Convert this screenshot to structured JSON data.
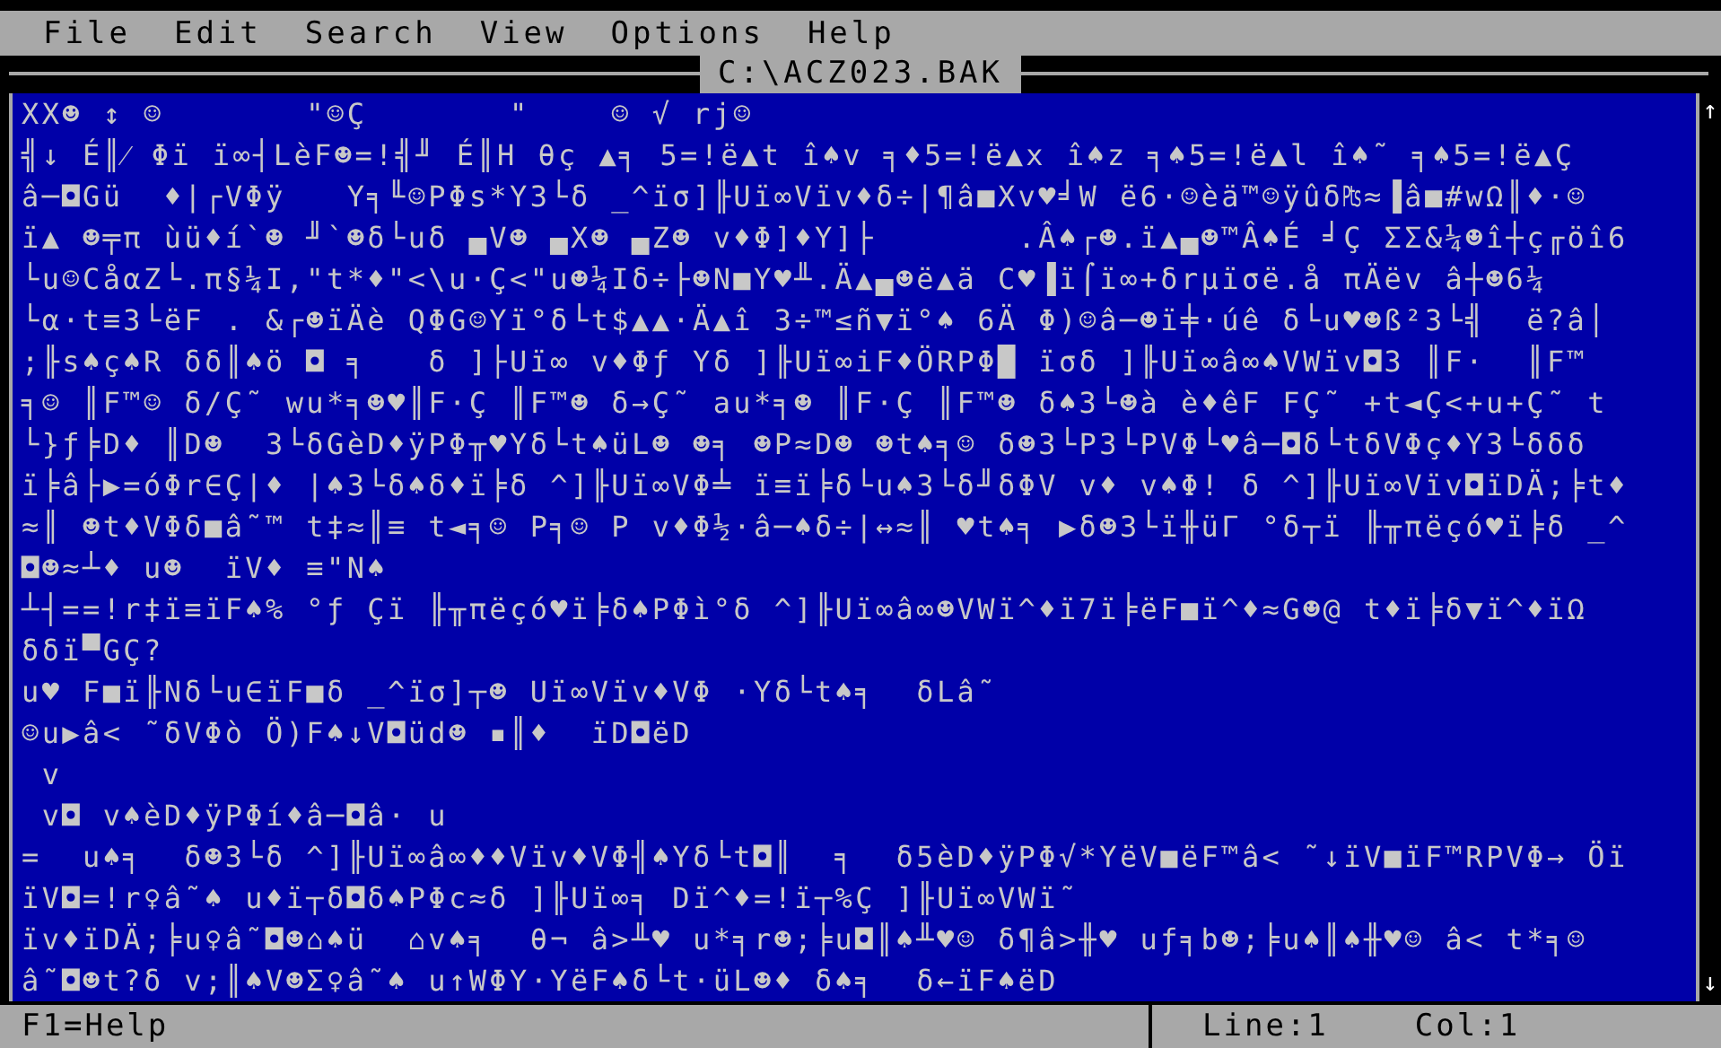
{
  "menu": [
    "File",
    "Edit",
    "Search",
    "View",
    "Options",
    "Help"
  ],
  "window": {
    "title": "C:\\ACZ023.BAK"
  },
  "lines": [
    "XX☻ ↕ ☺       \"☺Ç       \"    ☺ √ rj☺",
    "╣↓ É║⁄ Φï ï∞┤LèF☻=!╣╜ É║H θç ▲╕ 5=!ë▲t î♠v ╕♦5=!ë▲x î♠z ╕♠5=!ë▲l î♠˜ ╕♠5=!ë▲Ç",
    "â─◘Gü  ♦|┌VΦÿ   Y╕╙☺PΦs*Y3└δ _^ïσ]╟Uï∞Vïv♦δ÷|¶â■Xv♥╛W ë6·☺èä™☺ÿûδ₧≈▐â■#wΩ║♦·☺",
    "ï▲ ☻╤π ùü♦í`☻ ╜`☻δ└uδ ▄V☻ ▄X☻ ▄Z☻ v♦Φ]♦Y]├       .Â♠┌☻.ï▲▄☻™Â♠É ╛Ç ΣΣ&¼☻î┼ç╓öî6",
    "└u☺CåαZ└.π§¼I,\"t*♦\"<\\u·Ç<\"u☻¼Iδ÷├☻N■Y♥╨.Ä▲▄☻ë▲ä C♥▐ï⌠ï∞+δrµïσë.å πÄëv â┼☻6¼",
    "└α·t≡3└ëF . &┌☻ïÄè QΦG☺Yï°δ└t$▲▲·Ä▲î 3÷™≤ñ▼ï°♠ 6Ä Φ)☺â─☻ï╪·úê δ└u♥☻ß²3└╣  ë?â│",
    ";╟s♠ç♠R δδ║♠ö ◘ ╕   δ ]├Uï∞ v♦Φƒ Yδ ]╟Uï∞iF♦ÖRPΦ█ ïσδ ]╟Uï∞â∞♠VWïv◘3 ║F·  ║F™",
    "╕☺ ║F™☺ δ/Ç˜ wu*╕☻♥║F·Ç ║F™☻ δ→Ç˜ au*╕☻ ║F·Ç ║F™☻ δ♠3└☻à è♦êF FÇ˜ +t◄Ç<+u+Ç˜ t",
    "└}ƒ╞D♦ ║D☻  3└δGèD♦ÿPΦ╥♥Yδ└t♠üL☻ ☻╕ ☻P≈D☻ ☻t♠╕☺ δ☻3└P3└PVΦ└♥â─◘δ└tδVΦç♦Y3└δδδ",
    "ï╞â├▶=óΦr∈Ç|♦ |♠3└δ♠δ♦ï╞δ ^]╟Uï∞VΦ╧ ï≡ï╞δ└u♠3└δ╜δΦV v♦ v♠Φ! δ ^]╟Uï∞Vïv◘ïDÄ;╞t♦",
    "≈║ ☻t♦VΦδ■â˜™ t‡≈║≡ t◄╕☺ P╕☺ P v♦Φ½·â─♠δ÷|↔≈║ ♥t♠╕ ▶δ☻3└ï╫üΓ °δ┬ï ╟╥πëçó♥ï╞δ _^",
    "◘☻≈┴♦ u☻  ïV♦ ≡\"N♠",
    "┴┤==!r‡ï≡ïF♠% °ƒ Çï ╟╥πëçó♥ï╞δ♠PΦì°δ ^]╟Uï∞â∞☻VWï^♦ï7ï╞ëF■ï^♦≈G☻@ t♦ï╞δ▼ï^♦ïΩ",
    "δδï▀GÇ?",
    "u♥ F■ï╟Nδ└u∈ïF■δ _^ïσ]┬☻ Uï∞Vïv♦VΦ ·Yδ└t♠╕  δLâ˜",
    "☺u▶â< ˜δVΦò Ö)F♠↓V◘üd☻ ▪║♦  ïD◘ëD",
    " v",
    " v◘ v♠èD♦ÿPΦí♦â─◘â· u",
    "=  u♠╕  δ☻3└δ ^]╟Uï∞â∞♦♦Vïv♦VΦ╢♠Yδ└t◘║  ╕  δ5èD♦ÿPΦ√*YëV■ëF™â< ˜↓ïV■ïF™RPVΦ→ Öï",
    "ïV◘=!r♀â˜♠ u♦ï┬δ◘δ♠PΦc≈δ ]╟Uï∞╕ Dï^♦=!ï┬%Ç ]╟Uï∞VWï˜",
    "ïv♦ïDÄ;╞u♀â˜◘☻⌂♠ü  ⌂v♠╕  θ¬ â>╨♥ u*╕r☻;╞u◘║♠╨♥☺ δ¶â>╫♥ uƒ╕b☻;╞u♠║♠╫♥☺ â< t*╕☺",
    "â˜◘☻t?δ v;║♠V☻Σ♀â˜♠ u↑WΦY·YëF♠δ└t·üL☻♦ δ♠╕  δ←ïF♠ëD"
  ],
  "scrollbar": {
    "up": "↑",
    "down": "↓"
  },
  "status_bar": {
    "help": "F1=Help",
    "line": "Line:1",
    "col": "Col:1"
  }
}
